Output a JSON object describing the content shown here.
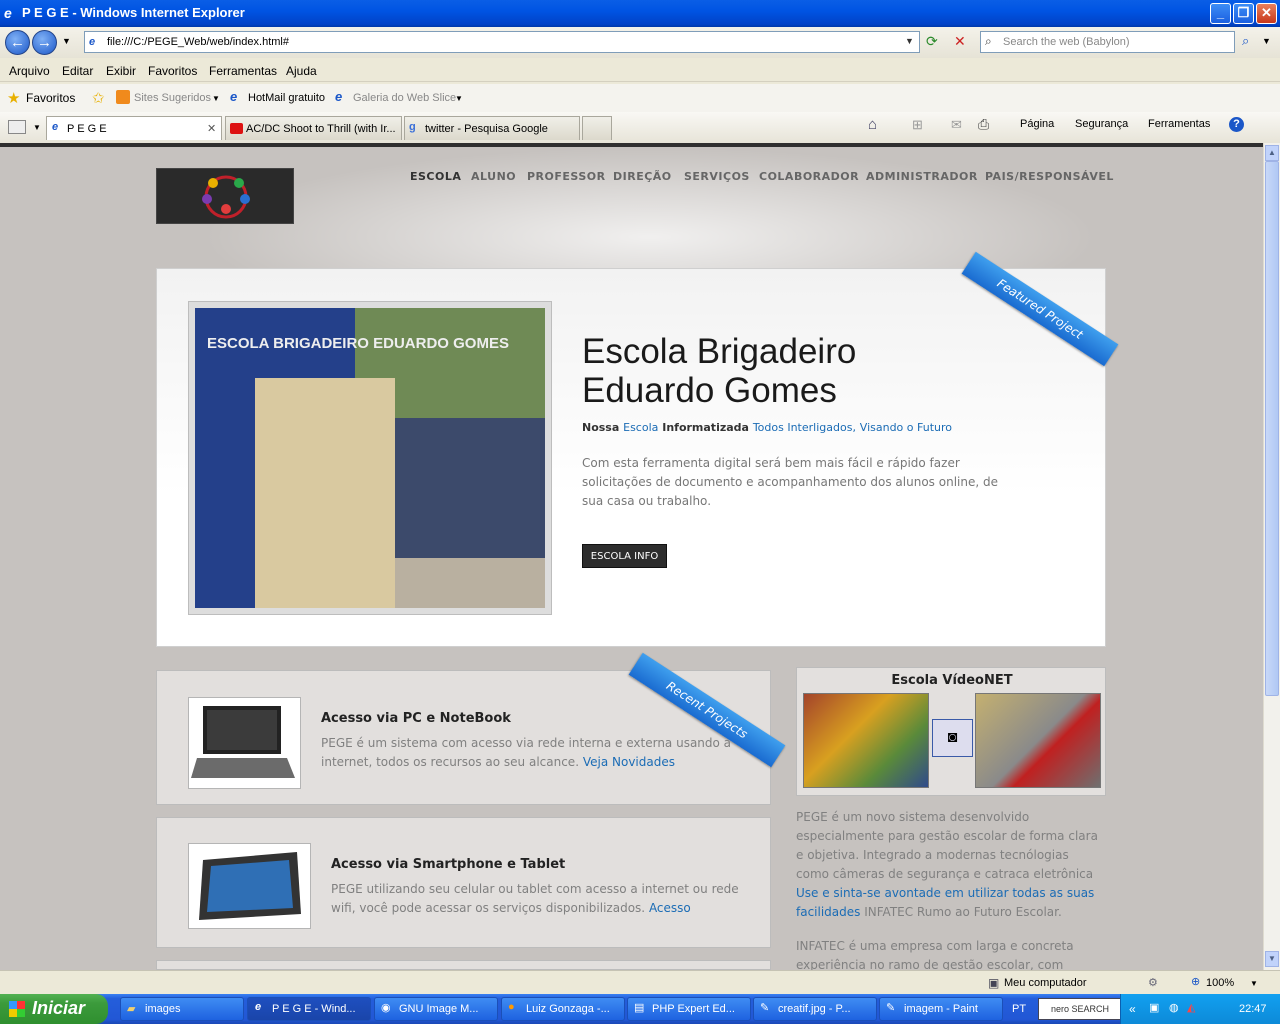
{
  "window": {
    "title": "P E G E - Windows Internet Explorer"
  },
  "address": {
    "url": "file:///C:/PEGE_Web/web/index.html#",
    "search_placeholder": "Search the web (Babylon)"
  },
  "menu": [
    "Arquivo",
    "Editar",
    "Exibir",
    "Favoritos",
    "Ferramentas",
    "Ajuda"
  ],
  "favorites": {
    "label": "Favoritos",
    "items": [
      "Sites Sugeridos",
      "HotMail gratuito",
      "Galeria do Web Slice"
    ]
  },
  "tabs": [
    "P E G E",
    "AC/DC Shoot to Thrill (with Ir...",
    "twitter - Pesquisa Google"
  ],
  "commandbar": [
    "Página",
    "Segurança",
    "Ferramentas"
  ],
  "site": {
    "nav": [
      "ESCOLA",
      "ALUNO",
      "PROFESSOR",
      "DIREÇÃO",
      "SERVIÇOS",
      "COLABORADOR",
      "ADMINISTRADOR",
      "PAIS/RESPONSÁVEL"
    ],
    "feature": {
      "ribbon": "Featured Project",
      "photo_sign": "ESCOLA BRIGADEIRO EDUARDO GOMES",
      "title_line1": "Escola Brigadeiro",
      "title_line2": "Eduardo Gomes",
      "tag_1": "Nossa",
      "tag_2": "Escola",
      "tag_3": "Informatizada",
      "tag_4": "Todos Interligados",
      "tag_5": ",",
      "tag_6": "Visando o Futuro",
      "description": "Com esta ferramenta digital será bem mais fácil e rápido fazer solicitações de documento e acompanhamento dos alunos online, de sua casa ou trabalho.",
      "button": "ESCOLA INFO"
    },
    "recent_ribbon": "Recent Projects",
    "cards": [
      {
        "title": "Acesso via PC e NoteBook",
        "body": "PEGE é um sistema com acesso via rede interna e externa usando a internet, todos os recursos ao seu alcance.",
        "link": "Veja Novidades"
      },
      {
        "title": "Acesso via Smartphone e Tablet",
        "body": "PEGE utilizando seu celular ou tablet com acesso a internet ou rede wifi, você pode acessar os serviços disponibilizados.",
        "link": "Acesso"
      }
    ],
    "videonet": {
      "title": "Escola VídeoNET"
    },
    "aside": {
      "p1_text": "PEGE é um novo sistema desenvolvido especialmente para gestão escolar de forma clara e objetiva. Integrado a modernas tecnólogias como câmeras de segurança e catraca eletrônica",
      "p1_link": "Use e sinta-se avontade em utilizar todas as suas facilidades",
      "p1_tail": "INFATEC Rumo ao Futuro Escolar.",
      "p2_text": "INFATEC é uma empresa com larga e concreta experiência no ramo de gestão escolar, com"
    }
  },
  "status": {
    "zone": "Meu computador",
    "zoom": "100%"
  },
  "taskbar": {
    "start": "Iniciar",
    "items": [
      "images",
      "P E G E - Wind...",
      "GNU Image M...",
      "Luiz Gonzaga -...",
      "PHP Expert Ed...",
      "creatif.jpg - P...",
      "imagem - Paint"
    ],
    "lang": "PT",
    "nero": "nero SEARCH",
    "clock": "22:47"
  },
  "colors": {
    "accent": "#1b6cb5",
    "ribbon": "#1a6bd0",
    "page_bg": "#c6c2bf"
  }
}
